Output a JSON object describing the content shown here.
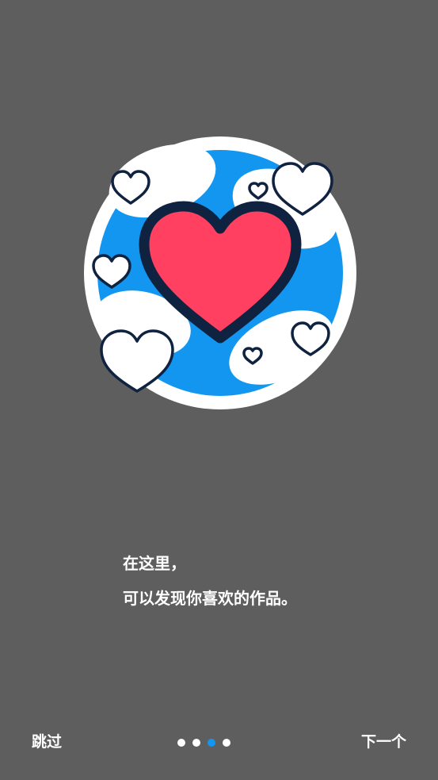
{
  "onboarding": {
    "message_line1": "在这里，",
    "message_line2": "可以发现你喜欢的作品。",
    "skip_label": "跳过",
    "next_label": "下一个",
    "page_indicator": {
      "total": 4,
      "current": 3
    }
  },
  "colors": {
    "background": "#5e5e5e",
    "accent": "#1296f0",
    "heart": "#ff4060",
    "outline": "#0f2240"
  },
  "icons": {
    "illustration": "heart-illustration-icon"
  }
}
